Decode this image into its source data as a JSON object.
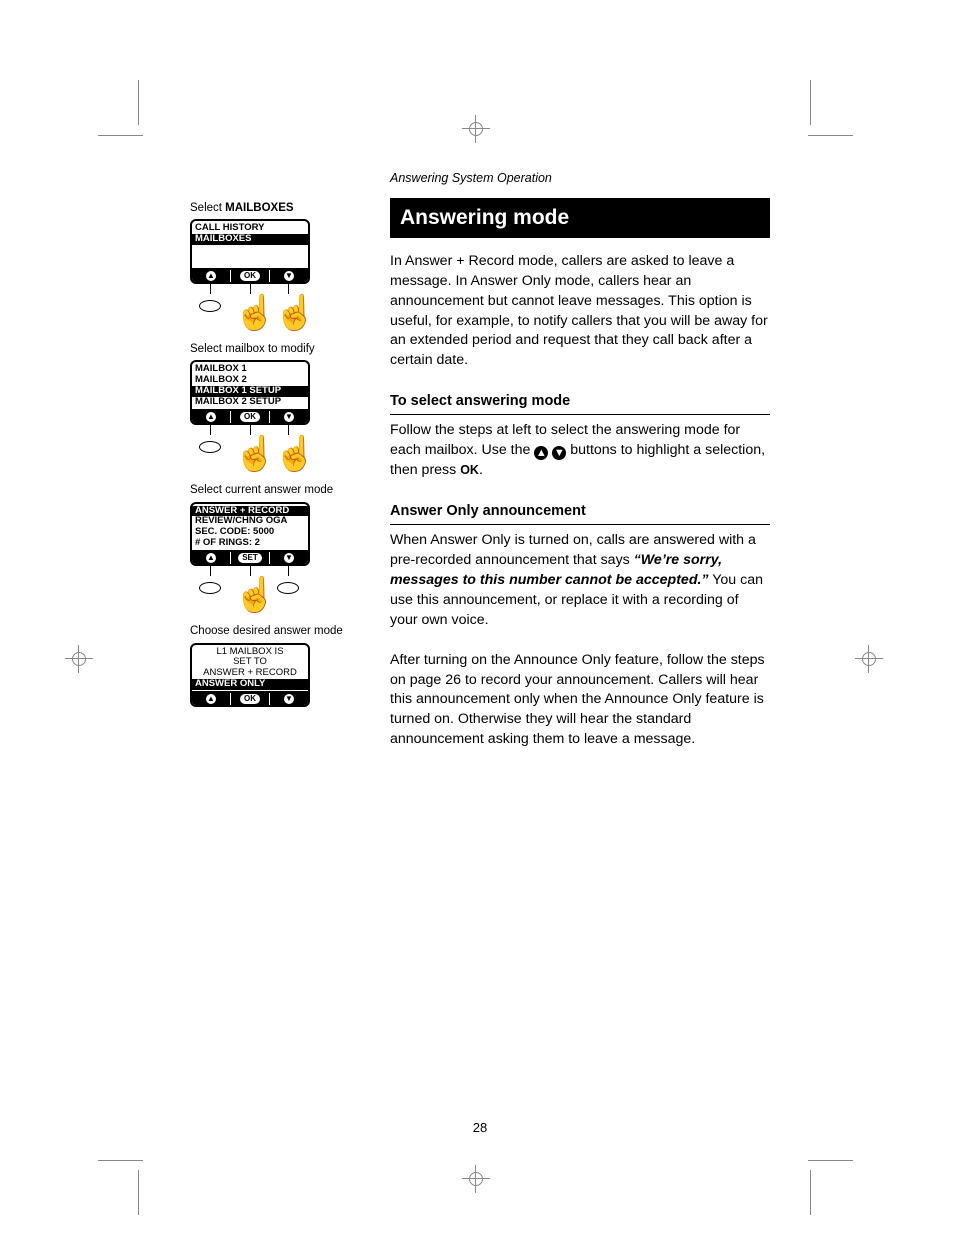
{
  "breadcrumb": "Answering System Operation",
  "title": "Answering mode",
  "intro": "In Answer + Record mode, callers are asked to leave a message. In Answer Only mode, callers hear an announcement but cannot leave messages. This option is useful, for example, to notify callers that you will be away for an extended period and request that they call back after a certain date.",
  "section1_hdr": "To select answering mode",
  "section1_body_a": "Follow the steps at left to select the answering mode for each mailbox. Use the ",
  "section1_body_b": " buttons to highlight a selection, then press ",
  "ok_label": "OK",
  "section1_body_c": ".",
  "section2_hdr": "Answer Only announcement",
  "section2_p1_a": "When Answer Only is turned on, calls are answered with a pre-recorded announcement  that says ",
  "section2_p1_quote": "“We’re sorry, messages to this number cannot be accepted.”",
  "section2_p1_b": " You can use this announcement, or replace it with a recording of your own voice.",
  "section2_p2": "After turning on the Announce Only feature, follow the steps on page 26 to record your announcement. Callers will hear this announcement only when the Announce Only feature is turned on. Otherwise they will hear the standard announcement asking them to leave a message.",
  "pagenum": "28",
  "left": {
    "cap1_a": "Select ",
    "cap1_b": "MAILBOXES",
    "cap2": "Select mailbox to modify",
    "cap3": "Select current answer mode",
    "cap4": "Choose desired answer mode",
    "lcd1": {
      "r1": "CALL HISTORY",
      "r2": "MAILBOXES",
      "soft_mid": "OK"
    },
    "lcd2": {
      "r1": "MAILBOX 1",
      "r2": "MAILBOX 2",
      "r3": "MAILBOX 1 SETUP",
      "r4": "MAILBOX 2 SETUP",
      "soft_mid": "OK"
    },
    "lcd3": {
      "r1": "ANSWER + RECORD",
      "r2": "REVIEW/CHNG OGA",
      "r3": "SEC. CODE: 5000",
      "r4": "# OF RINGS: 2",
      "soft_mid": "SET"
    },
    "lcd4": {
      "r1": "L1 MAILBOX IS",
      "r2": "SET TO",
      "r3": "ANSWER + RECORD",
      "r4": "ANSWER ONLY",
      "soft_mid": "OK"
    }
  }
}
